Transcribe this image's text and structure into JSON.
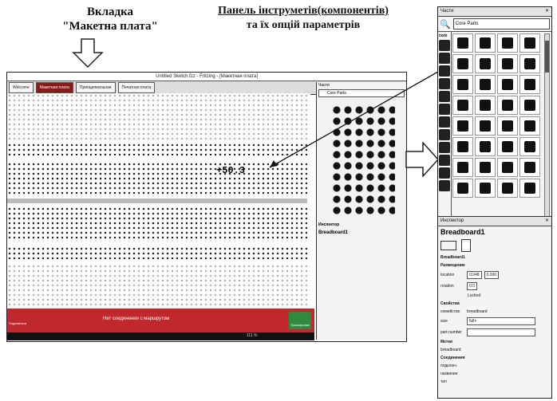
{
  "annotations": {
    "left_title_line1": "Вкладка",
    "left_title_line2": "\"Макетна плата\"",
    "right_title_line1": "Панель інструметів(компонентів)",
    "right_title_line2": "та їх опцій параметрів"
  },
  "window": {
    "title": "Untitled Sketch.fzz - Fritzing - [Макетная плата]",
    "tabs": [
      {
        "label": "Welcome"
      },
      {
        "label": "Макетная плата"
      },
      {
        "label": "Принципиальная"
      },
      {
        "label": "Печатная плата"
      }
    ]
  },
  "board": {
    "label": "+50.3"
  },
  "status": {
    "message": "Нет соединения с маршрутом",
    "route_button": "Трассировка",
    "share_button": "Поделиться",
    "zoom": "111 %"
  },
  "parts_panel": {
    "title": "Части",
    "search_value": "Core Parts",
    "category": "core"
  },
  "inspector": {
    "title": "Инспектор",
    "part_name": "Breadboard1",
    "subtitle": "Breadboard1",
    "placement_label": "Размещение",
    "location_label": "location",
    "location_x": "0.048",
    "location_y": "0.000",
    "rotation_label": "rotation",
    "rotation_value": "0.0",
    "locked_label": "Locked",
    "properties_label": "Свойства",
    "family_label": "семейство",
    "family_value": "breadboard",
    "size_label": "size",
    "size_value": "full+",
    "part_number_label": "part number",
    "tags_label": "Метки",
    "tags_value": "breadboard",
    "connections_label": "Соединения",
    "conn_label": "подключ.",
    "name_label": "название",
    "type_label": "тип"
  }
}
